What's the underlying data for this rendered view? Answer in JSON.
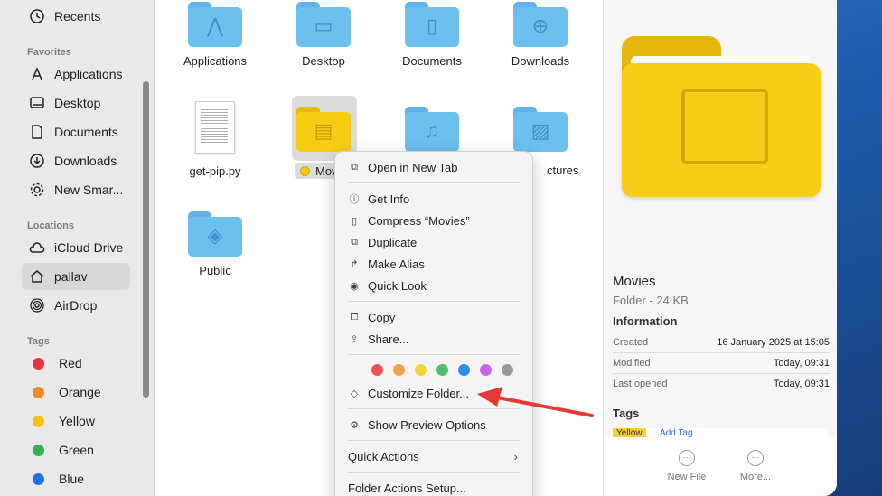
{
  "sidebar": {
    "recents": "Recents",
    "favorites_title": "Favorites",
    "favorites": [
      "Applications",
      "Desktop",
      "Documents",
      "Downloads",
      "New Smar..."
    ],
    "locations_title": "Locations",
    "locations": [
      "iCloud Drive",
      "pallav",
      "AirDrop"
    ],
    "tags_title": "Tags",
    "tags": [
      {
        "label": "Red",
        "color": "#e8343a"
      },
      {
        "label": "Orange",
        "color": "#f08a24"
      },
      {
        "label": "Yellow",
        "color": "#f3c413"
      },
      {
        "label": "Green",
        "color": "#2fb54a"
      },
      {
        "label": "Blue",
        "color": "#1f73e6"
      }
    ]
  },
  "files": {
    "applications": "Applications",
    "desktop": "Desktop",
    "documents": "Documents",
    "downloads": "Downloads",
    "getpip": "get-pip.py",
    "movies_trunc": "Mov",
    "pictures_trunc": "ctures",
    "public": "Public"
  },
  "menu": {
    "open_new_tab": "Open in New Tab",
    "get_info": "Get Info",
    "compress": "Compress “Movies”",
    "duplicate": "Duplicate",
    "make_alias": "Make Alias",
    "quick_look": "Quick Look",
    "copy": "Copy",
    "share": "Share...",
    "customize_folder": "Customize Folder...",
    "show_preview_options": "Show Preview Options",
    "quick_actions": "Quick Actions",
    "folder_actions_setup": "Folder Actions Setup...",
    "tag_colors": [
      "#ef5350",
      "#f4a04a",
      "#f3d33a",
      "#4cc069",
      "#2f8cf0",
      "#c865e0",
      "#9a9a9a"
    ]
  },
  "preview": {
    "name": "Movies",
    "kind": "Folder - 24 KB",
    "information_title": "Information",
    "created_label": "Created",
    "created_value": "16 January 2025 at 15:05",
    "modified_label": "Modified",
    "modified_value": "Today, 09:31",
    "last_opened_label": "Last opened",
    "last_opened_value": "Today, 09:31",
    "tags_title": "Tags",
    "tag_yellow": "Yellow",
    "add_tag": "Add Tag",
    "new_file": "New File",
    "more": "More..."
  },
  "annotation": {
    "arrow_color": "#e53935"
  }
}
